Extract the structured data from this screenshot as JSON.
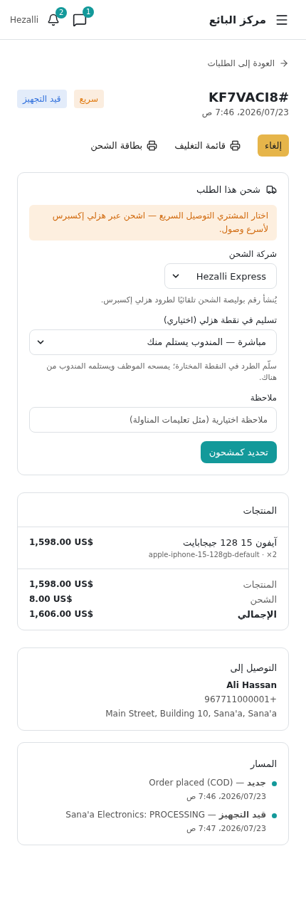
{
  "header": {
    "title": "مركز البائع",
    "messages_badge": "1",
    "notifications_badge": "2",
    "brand": "Hezalli"
  },
  "back_link": "العودة إلى الطلبات",
  "order": {
    "number": "KF7VACI8#",
    "date": "2026/07/23، 7:46 ص",
    "badges": [
      {
        "label": "سريع",
        "color": "#e07a10"
      },
      {
        "label": "قيد التجهيز",
        "color": "#2f6fdc"
      }
    ]
  },
  "actions": [
    {
      "label": "إلغاء",
      "kind": "primary"
    },
    {
      "label": "قائمة التغليف",
      "kind": "print"
    },
    {
      "label": "بطاقة الشحن",
      "kind": "print"
    }
  ],
  "ship_card": {
    "title": "شحن هذا الطلب",
    "notice": "اختار المشتري التوصيل السريع — اشحن عبر هزلي إكسبرس لأسرع وصول.",
    "carrier_label": "شركة الشحن",
    "carrier_value": "Hezalli Express",
    "carrier_hint": "يُنشأ رقم بوليصة الشحن تلقائيًا لطرود هزلي إكسبرس.",
    "point_label": "تسليم في نقطة هزلي (اختياري)",
    "point_value": "مباشرة — المندوب يستلم منك",
    "point_hint": "سلّم الطرد في النقطة المختارة؛ يمسحه الموظف ويستلمه المندوب من هناك.",
    "note_label": "ملاحظة",
    "note_placeholder": "ملاحظة اختيارية (مثل تعليمات المناولة)",
    "submit": "تحديد كمشحون"
  },
  "products_card": {
    "title": "المنتجات",
    "items": [
      {
        "name": "آيفون 15 128 جيجابايت",
        "sku": "apple-iphone-15-128gb-default · ×2",
        "price": "1,598.00 US$"
      }
    ],
    "totals": [
      {
        "label": "المنتجات",
        "value": "1,598.00 US$",
        "kind": "line"
      },
      {
        "label": "الشحن",
        "value": "8.00 US$",
        "kind": "line"
      },
      {
        "label": "الإجمالي",
        "value": "1,606.00 US$",
        "kind": "total"
      }
    ]
  },
  "delivery_card": {
    "title": "التوصيل إلى",
    "name": "Ali Hassan",
    "phone": "967711000001+",
    "address": "Main Street, Building 10, Sana'a, Sana'a"
  },
  "timeline_card": {
    "title": "المسار",
    "events": [
      {
        "text": "**جديد** — Order placed (COD)",
        "time": "2026/07/23، 7:46 ص"
      },
      {
        "text": "**قيد التجهيز** — Sana'a Electronics: PROCESSING",
        "time": "2026/07/23، 7:47 ص"
      }
    ]
  }
}
